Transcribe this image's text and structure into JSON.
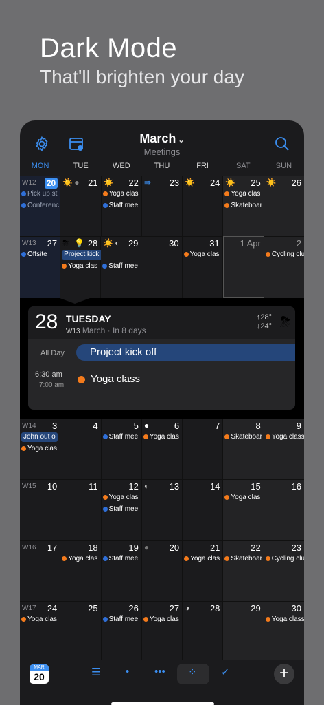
{
  "hero": {
    "title": "Dark Mode",
    "subtitle": "That'll brighten your day"
  },
  "header": {
    "month": "March",
    "calendar_name": "Meetings"
  },
  "days_of_week": [
    "MON",
    "TUE",
    "WED",
    "THU",
    "FRI",
    "SAT",
    "SUN"
  ],
  "weeks": [
    {
      "label": "W12",
      "days": [
        "20",
        "21",
        "22",
        "23",
        "24",
        "25",
        "26"
      ]
    },
    {
      "label": "W13",
      "days": [
        "27",
        "28",
        "29",
        "30",
        "31",
        "1 Apr",
        "2"
      ]
    },
    {
      "label": "W14",
      "days": [
        "3",
        "4",
        "5",
        "6",
        "7",
        "8",
        "9"
      ]
    },
    {
      "label": "W15",
      "days": [
        "10",
        "11",
        "12",
        "13",
        "14",
        "15",
        "16"
      ]
    },
    {
      "label": "W16",
      "days": [
        "17",
        "18",
        "19",
        "20",
        "21",
        "22",
        "23"
      ]
    },
    {
      "label": "W17",
      "days": [
        "24",
        "25",
        "26",
        "27",
        "28",
        "29",
        "30"
      ]
    }
  ],
  "events": {
    "pick_up": "Pick up st",
    "conference": "Conferenc",
    "yoga": "Yoga clas",
    "yoga_full": "Yoga class",
    "staff": "Staff mee",
    "skate": "Skateboar",
    "offsite": "Offsite",
    "kickoff": "Project kick off",
    "cycling": "Cycling clu",
    "john": "John out o"
  },
  "detail": {
    "day": "28",
    "weekday": "TUESDAY",
    "week": "W13",
    "month": "March",
    "relative": "In 8 days",
    "temp_high": "↑28°",
    "temp_low": "↓24°",
    "allday_label": "All Day",
    "allday_event": "Project kick off",
    "start_time": "6:30 am",
    "end_time": "7:00 am",
    "timed_event": "Yoga class"
  },
  "bottom": {
    "cal_month": "MAR",
    "cal_day": "20"
  },
  "colors": {
    "accent": "#3b8ef0",
    "orange": "#f47b1c",
    "blue_event": "#2f6fd8",
    "allday": "#25467a"
  }
}
